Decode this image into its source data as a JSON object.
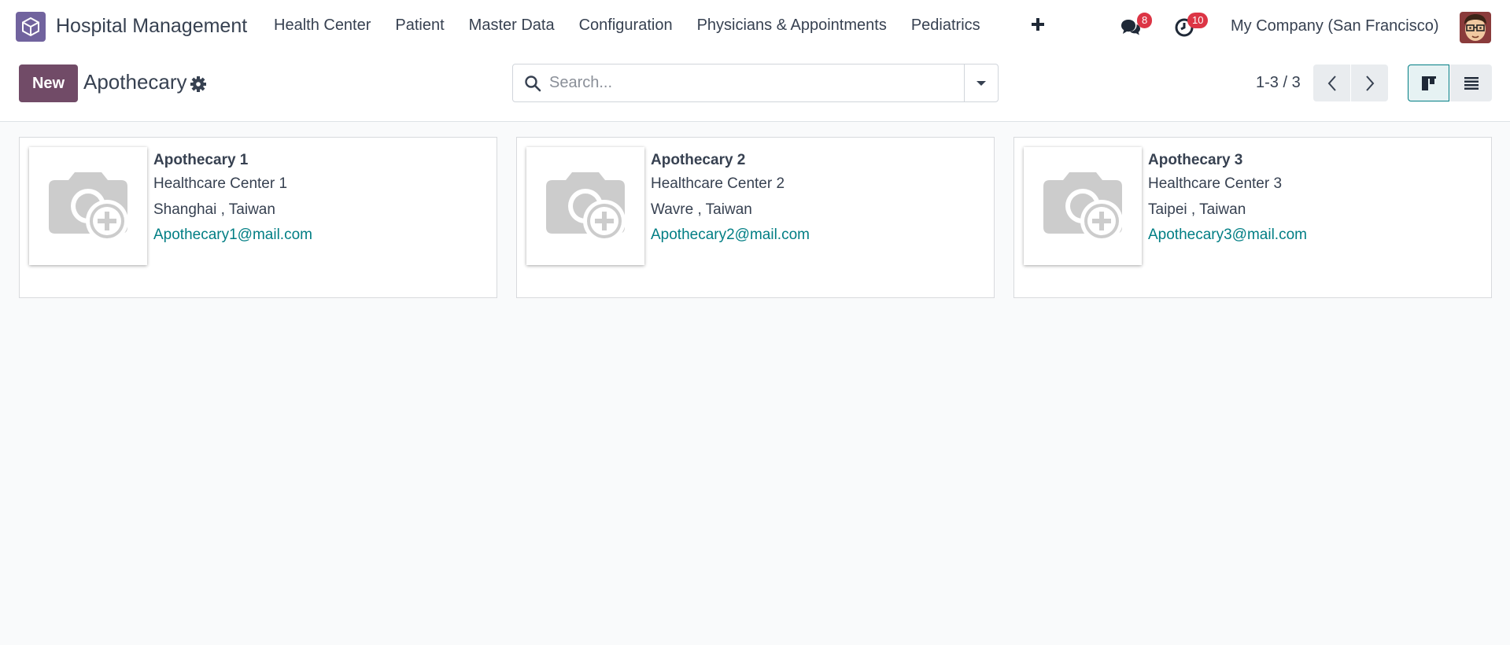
{
  "navbar": {
    "app_name": "Hospital Management",
    "menu": [
      "Health Center",
      "Patient",
      "Master Data",
      "Configuration",
      "Physicians & Appointments",
      "Pediatrics"
    ],
    "messages_count": "8",
    "activities_count": "10",
    "company": "My Company (San Francisco)",
    "icons": {
      "logo": "app-box-icon",
      "add": "plus-icon",
      "messages": "chat-icon",
      "activities": "clock-icon"
    }
  },
  "control_panel": {
    "new_label": "New",
    "breadcrumb": "Apothecary",
    "search_placeholder": "Search...",
    "pager": "1-3 / 3"
  },
  "cards": [
    {
      "title": "Apothecary 1",
      "center": "Healthcare Center 1",
      "location": "Shanghai , Taiwan",
      "email": "Apothecary1@mail.com"
    },
    {
      "title": "Apothecary 2",
      "center": "Healthcare Center 2",
      "location": "Wavre , Taiwan",
      "email": "Apothecary2@mail.com"
    },
    {
      "title": "Apothecary 3",
      "center": "Healthcare Center 3",
      "location": "Taipei , Taiwan",
      "email": "Apothecary3@mail.com"
    }
  ],
  "colors": {
    "brand": "#714b67",
    "link": "#017e84",
    "badge": "#dc3545",
    "background": "#f9fafb"
  }
}
